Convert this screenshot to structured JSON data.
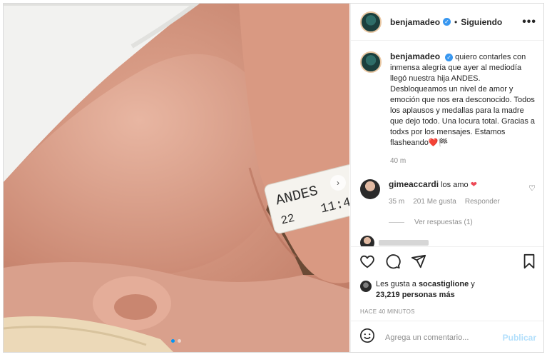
{
  "header": {
    "username": "benjamadeo",
    "separator": "•",
    "follow_status": "Siguiendo",
    "more": "•••"
  },
  "caption": {
    "username": "benjamadeo",
    "text": "quiero contarles con inmensa alegría que ayer al mediodía llegó nuestra hija ANDES. Desbloqueamos un nivel de amor y emoción que nos era desconocido. Todos los aplausos y medallas para la madre que dejo todo. Una locura total. Gracias a todxs por los mensajes. Estamos flasheando",
    "emoji": "❤️🏁",
    "time": "40 m"
  },
  "comment": {
    "username": "gimeaccardi",
    "text": "los amo",
    "emoji": "❤",
    "time": "35 m",
    "likes": "201 Me gusta",
    "reply": "Responder",
    "view_replies": "Ver respuestas (1)"
  },
  "likes": {
    "prefix": "Les gusta a",
    "user": "socastiglione",
    "and": "y",
    "count": "23,219 personas más"
  },
  "timestamp": "HACE 40 MINUTOS",
  "composer": {
    "placeholder": "Agrega un comentario...",
    "post": "Publicar"
  },
  "photo": {
    "band_text": "ANDES",
    "band_text2": "11:4",
    "band_text3": "22"
  },
  "icons": [
    "verified-icon",
    "heart-icon",
    "comment-icon",
    "share-icon",
    "save-icon",
    "emoji-icon",
    "next-icon"
  ]
}
